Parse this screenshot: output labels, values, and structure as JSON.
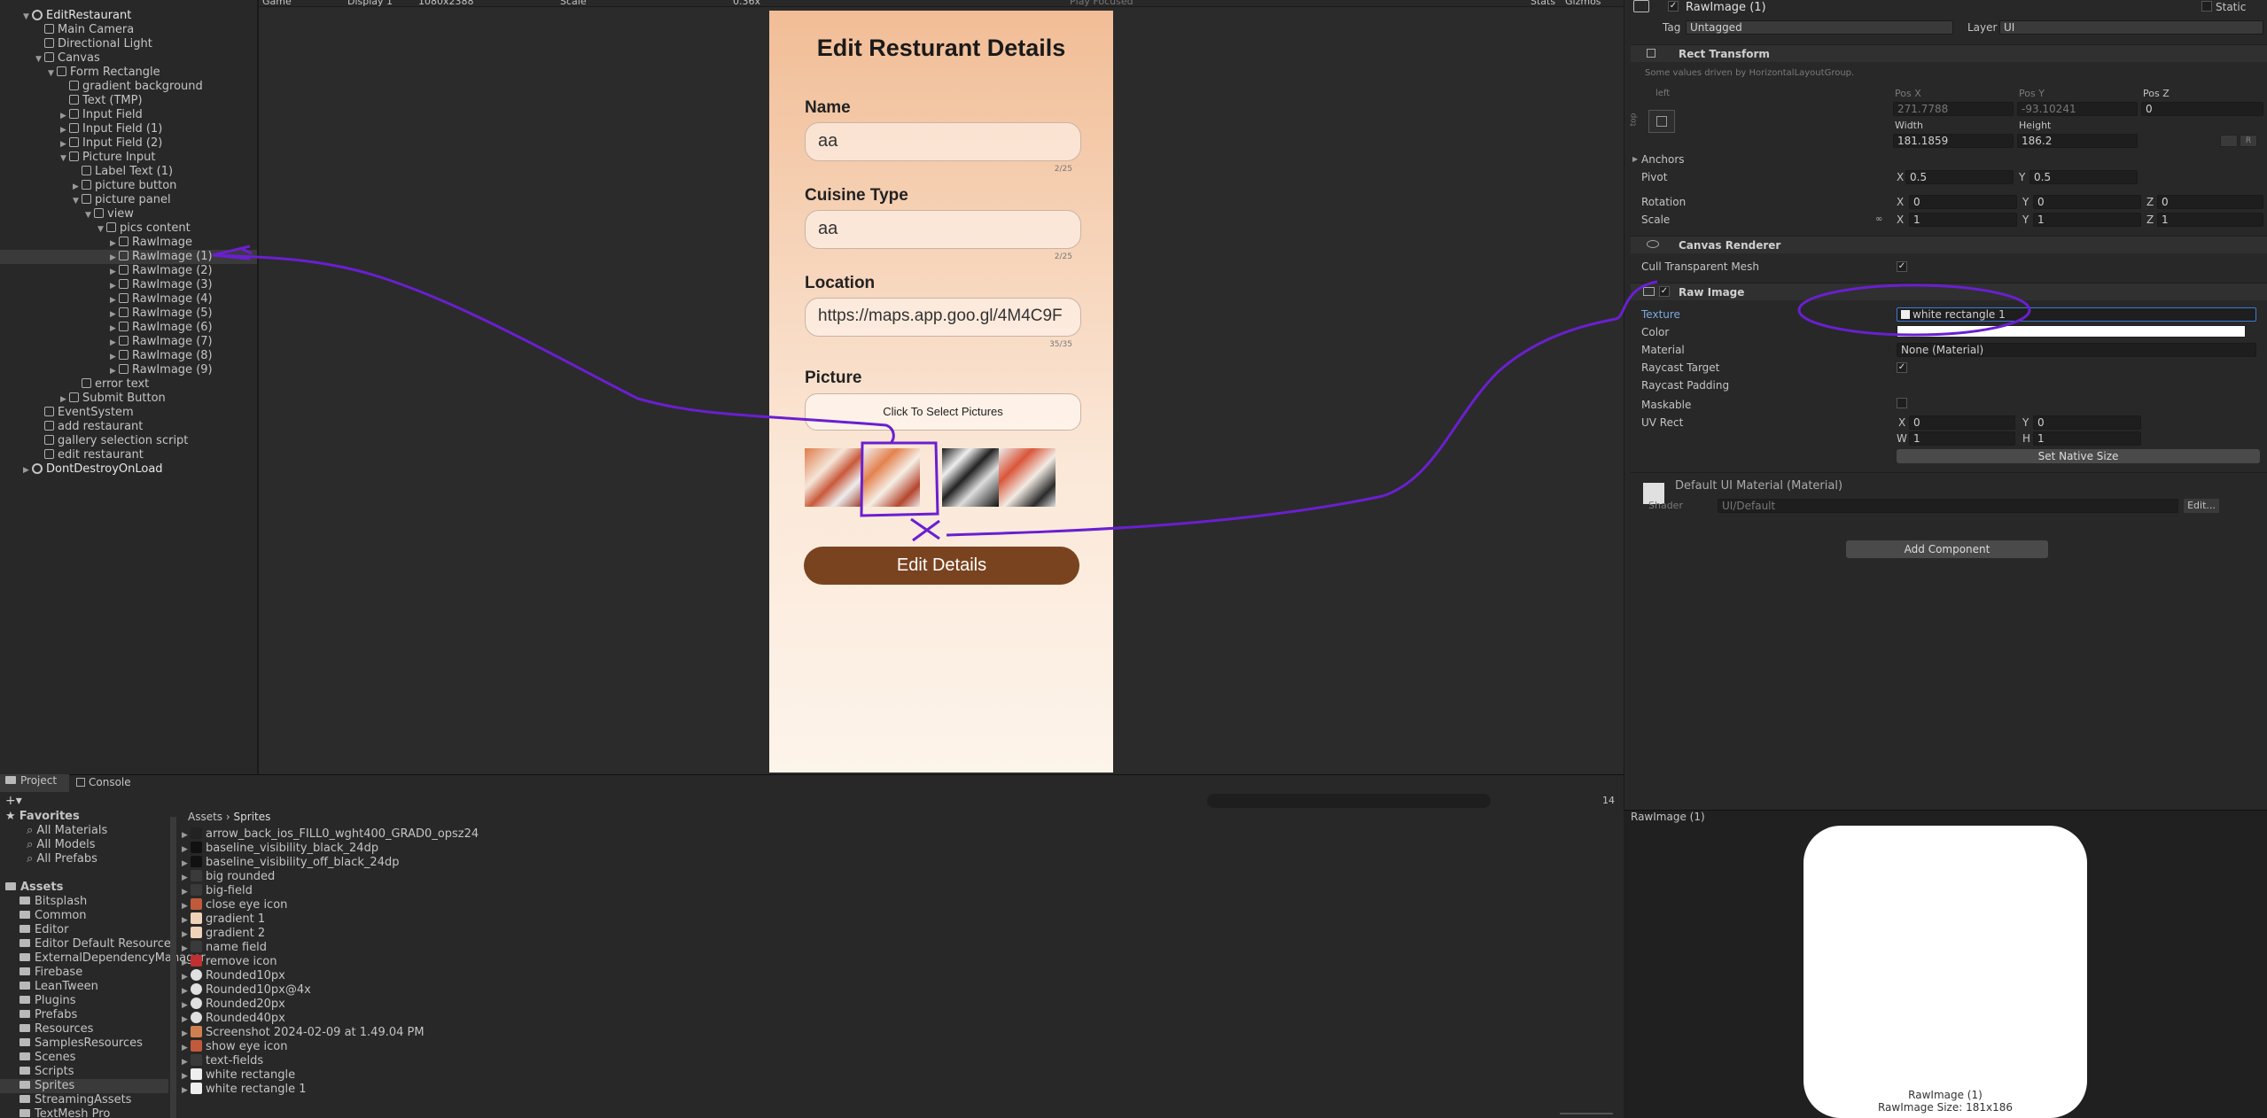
{
  "toolbar": {
    "game_tab": "Game",
    "display": "Display 1",
    "resolution": "1080x2388",
    "scale_label": "Scale",
    "scale_value": "0.36x",
    "play_focused": "Play Focused",
    "stats": "Stats",
    "gizmos": "Gizmos"
  },
  "hierarchy": {
    "items": [
      {
        "label": "EditRestaurant",
        "depth": 0
      },
      {
        "label": "Main Camera",
        "depth": 1
      },
      {
        "label": "Directional Light",
        "depth": 1
      },
      {
        "label": "Canvas",
        "depth": 1
      },
      {
        "label": "Form Rectangle",
        "depth": 2
      },
      {
        "label": "gradient background",
        "depth": 3
      },
      {
        "label": "Text (TMP)",
        "depth": 3
      },
      {
        "label": "Input Field",
        "depth": 3
      },
      {
        "label": "Input Field (1)",
        "depth": 3
      },
      {
        "label": "Input Field (2)",
        "depth": 3
      },
      {
        "label": "Picture Input",
        "depth": 3
      },
      {
        "label": "Label Text (1)",
        "depth": 4
      },
      {
        "label": "picture button",
        "depth": 4
      },
      {
        "label": "picture panel",
        "depth": 4
      },
      {
        "label": "view",
        "depth": 5
      },
      {
        "label": "pics content",
        "depth": 6
      },
      {
        "label": "RawImage",
        "depth": 7
      },
      {
        "label": "RawImage (1)",
        "depth": 7
      },
      {
        "label": "RawImage (2)",
        "depth": 7
      },
      {
        "label": "RawImage (3)",
        "depth": 7
      },
      {
        "label": "RawImage (4)",
        "depth": 7
      },
      {
        "label": "RawImage (5)",
        "depth": 7
      },
      {
        "label": "RawImage (6)",
        "depth": 7
      },
      {
        "label": "RawImage (7)",
        "depth": 7
      },
      {
        "label": "RawImage (8)",
        "depth": 7
      },
      {
        "label": "RawImage (9)",
        "depth": 7
      },
      {
        "label": "error text",
        "depth": 4
      },
      {
        "label": "Submit Button",
        "depth": 3
      },
      {
        "label": "EventSystem",
        "depth": 1
      },
      {
        "label": "add restaurant",
        "depth": 1
      },
      {
        "label": "gallery selection script",
        "depth": 1
      },
      {
        "label": "edit restaurant",
        "depth": 1
      },
      {
        "label": "DontDestroyOnLoad",
        "depth": 0
      }
    ]
  },
  "mobile": {
    "title": "Edit Resturant Details",
    "name_label": "Name",
    "name_value": "aa",
    "name_count": "2/25",
    "cuisine_label": "Cuisine Type",
    "cuisine_value": "aa",
    "cuisine_count": "2/25",
    "location_label": "Location",
    "location_value": "https://maps.app.goo.gl/4M4C9F",
    "location_count": "35/35",
    "picture_label": "Picture",
    "select_pictures": "Click To Select Pictures",
    "submit": "Edit Details"
  },
  "inspector": {
    "object_name": "RawImage (1)",
    "static_label": "Static",
    "tag_label": "Tag",
    "tag_value": "Untagged",
    "layer_label": "Layer",
    "layer_value": "UI",
    "rect_transform": "Rect Transform",
    "driven_note": "Some values driven by HorizontalLayoutGroup.",
    "anchor_preset": "left",
    "anchor_side": "top",
    "pos_x_label": "Pos X",
    "pos_x": "271.7788",
    "pos_y_label": "Pos Y",
    "pos_y": "-93.10241",
    "pos_z_label": "Pos Z",
    "pos_z": "0",
    "width_label": "Width",
    "width": "181.1859",
    "height_label": "Height",
    "height": "186.2",
    "anchors_label": "Anchors",
    "pivot_label": "Pivot",
    "pivot_x": "0.5",
    "pivot_y": "0.5",
    "rotation_label": "Rotation",
    "rot_x": "0",
    "rot_y": "0",
    "rot_z": "0",
    "scale_label": "Scale",
    "scale_x": "1",
    "scale_y": "1",
    "scale_z": "1",
    "canvas_renderer": "Canvas Renderer",
    "cull_label": "Cull Transparent Mesh",
    "raw_image": "Raw Image",
    "texture_label": "Texture",
    "texture_value": "white rectangle 1",
    "color_label": "Color",
    "material_label": "Material",
    "material_value": "None (Material)",
    "raycast_target_label": "Raycast Target",
    "raycast_padding_label": "Raycast Padding",
    "maskable_label": "Maskable",
    "uvrect_label": "UV Rect",
    "uv_x": "0",
    "uv_y": "0",
    "uv_w": "1",
    "uv_h": "1",
    "set_native": "Set Native Size",
    "material_title": "Default UI Material (Material)",
    "shader_label": "Shader",
    "shader_value": "UI/Default",
    "edit_button": "Edit...",
    "add_component": "Add Component",
    "axis_x": "X",
    "axis_y": "Y",
    "axis_z": "Z",
    "axis_w": "W",
    "axis_h": "H",
    "rect_r": "R"
  },
  "project": {
    "tab_project": "Project",
    "tab_console": "Console",
    "hidden_count": "14",
    "breadcrumb_root": "Assets",
    "breadcrumb_sep": "›",
    "breadcrumb_leaf": "Sprites",
    "favorites_label": "Favorites",
    "favorites": [
      "All Materials",
      "All Models",
      "All Prefabs"
    ],
    "assets_label": "Assets",
    "folders": [
      "Bitsplash",
      "Common",
      "Editor",
      "Editor Default Resources",
      "ExternalDependencyManager",
      "Firebase",
      "LeanTween",
      "Plugins",
      "Prefabs",
      "Resources",
      "SamplesResources",
      "Scenes",
      "Scripts",
      "Sprites",
      "StreamingAssets",
      "TextMesh Pro"
    ],
    "files": [
      "arrow_back_ios_FILL0_wght400_GRAD0_opsz24",
      "baseline_visibility_black_24dp",
      "baseline_visibility_off_black_24dp",
      "big rounded",
      "big-field",
      "close eye icon",
      "gradient 1",
      "gradient 2",
      "name field",
      "remove icon",
      "Rounded10px",
      "Rounded10px@4x",
      "Rounded20px",
      "Rounded40px",
      "Screenshot 2024-02-09 at 1.49.04 PM",
      "show eye icon",
      "text-fields",
      "white rectangle",
      "white rectangle 1"
    ]
  },
  "preview": {
    "title": "RawImage (1)",
    "caption_line1": "RawImage (1)",
    "caption_line2": "RawImage Size: 181x186"
  }
}
